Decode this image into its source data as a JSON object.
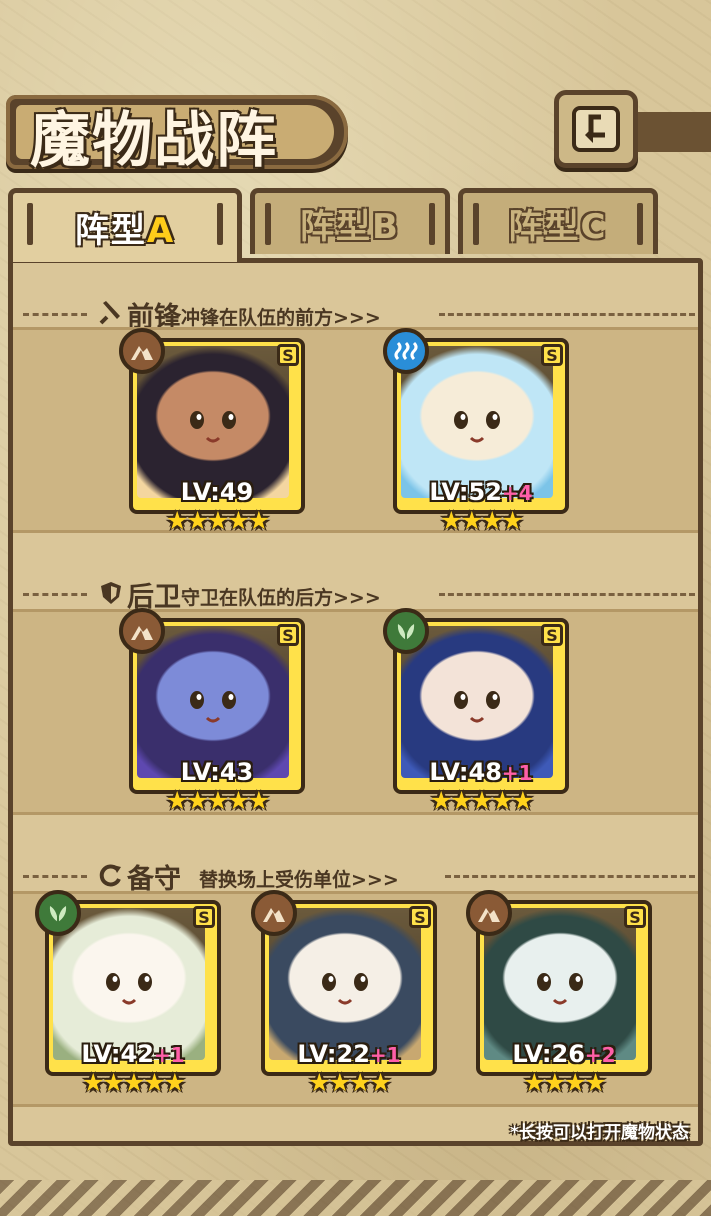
{
  "header": {
    "title": "魔物战阵",
    "back_icon": "back-arrow-icon"
  },
  "tabs": [
    {
      "prefix": "阵型",
      "letter": "A",
      "active": true
    },
    {
      "prefix": "阵型",
      "letter": "B",
      "active": false
    },
    {
      "prefix": "阵型",
      "letter": "C",
      "active": false
    }
  ],
  "sections": {
    "front": {
      "name": "前锋",
      "desc": "冲锋在队伍的前方>>>",
      "icon": "sword-icon"
    },
    "back": {
      "name": "后卫",
      "desc": "守卫在队伍的后方>>>",
      "icon": "shield-icon"
    },
    "reserve": {
      "name": "备守",
      "desc": "替换场上受伤单位>>>",
      "icon": "swap-icon"
    }
  },
  "units": [
    {
      "level": "LV:49",
      "plus": "",
      "rank": "S",
      "stars": 5,
      "element": "earth",
      "elem_color": "#8a5a36",
      "portrait": [
        "#2b2330",
        "#c58a66",
        "#f4d6a0"
      ]
    },
    {
      "level": "LV:52",
      "plus": "+4",
      "rank": "S",
      "stars": 4,
      "element": "water",
      "elem_color": "#2a8ed8",
      "portrait": [
        "#bfe6f6",
        "#f6ecd8",
        "#7cc4e8"
      ]
    },
    {
      "level": "LV:43",
      "plus": "",
      "rank": "S",
      "stars": 5,
      "element": "earth",
      "elem_color": "#8a5a36",
      "portrait": [
        "#3a2f6c",
        "#7d8bd8",
        "#5e48b0"
      ]
    },
    {
      "level": "LV:48",
      "plus": "+1",
      "rank": "S",
      "stars": 5,
      "element": "nature",
      "elem_color": "#3f7a3a",
      "portrait": [
        "#283a80",
        "#f3e3d8",
        "#3e5ab8"
      ]
    },
    {
      "level": "LV:42",
      "plus": "+1",
      "rank": "S",
      "stars": 5,
      "element": "nature",
      "elem_color": "#3f7a3a",
      "portrait": [
        "#e6ecd8",
        "#fbf6ee",
        "#9ab080"
      ]
    },
    {
      "level": "LV:22",
      "plus": "+1",
      "rank": "S",
      "stars": 4,
      "element": "earth",
      "elem_color": "#8a5a36",
      "portrait": [
        "#3a4a60",
        "#f5efe6",
        "#c8a870"
      ]
    },
    {
      "level": "LV:26",
      "plus": "+2",
      "rank": "S",
      "stars": 4,
      "element": "earth",
      "elem_color": "#8a5a36",
      "portrait": [
        "#2f4a45",
        "#e8f0ee",
        "#5f8a84"
      ]
    }
  ],
  "hint": "*长按可以打开魔物状态"
}
